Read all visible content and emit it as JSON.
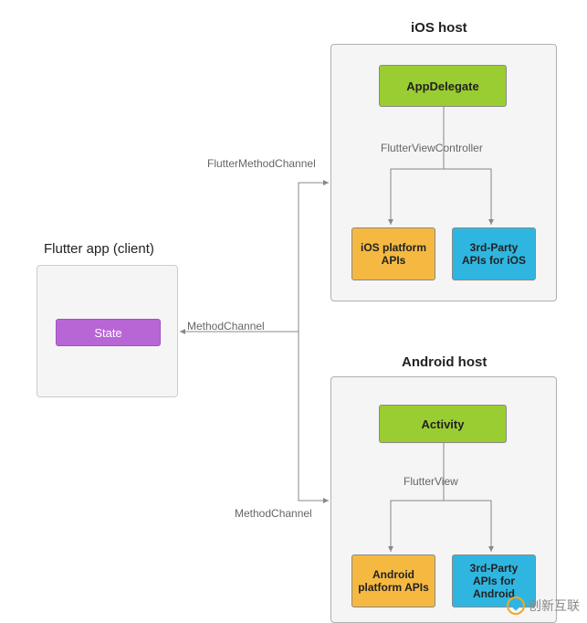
{
  "client": {
    "title": "Flutter app (client)",
    "state_label": "State"
  },
  "ios_host": {
    "title": "iOS host",
    "app_delegate": "AppDelegate",
    "flutter_view_controller_label": "FlutterViewController",
    "platform_apis": "iOS platform APIs",
    "third_party_apis": "3rd-Party APIs for iOS",
    "method_channel_label": "FlutterMethodChannel"
  },
  "android_host": {
    "title": "Android host",
    "activity": "Activity",
    "flutter_view_label": "FlutterView",
    "platform_apis": "Android platform APIs",
    "third_party_apis": "3rd-Party APIs for Android",
    "method_channel_label": "MethodChannel"
  },
  "shared": {
    "method_channel_label": "MethodChannel"
  },
  "watermark": "创新互联"
}
